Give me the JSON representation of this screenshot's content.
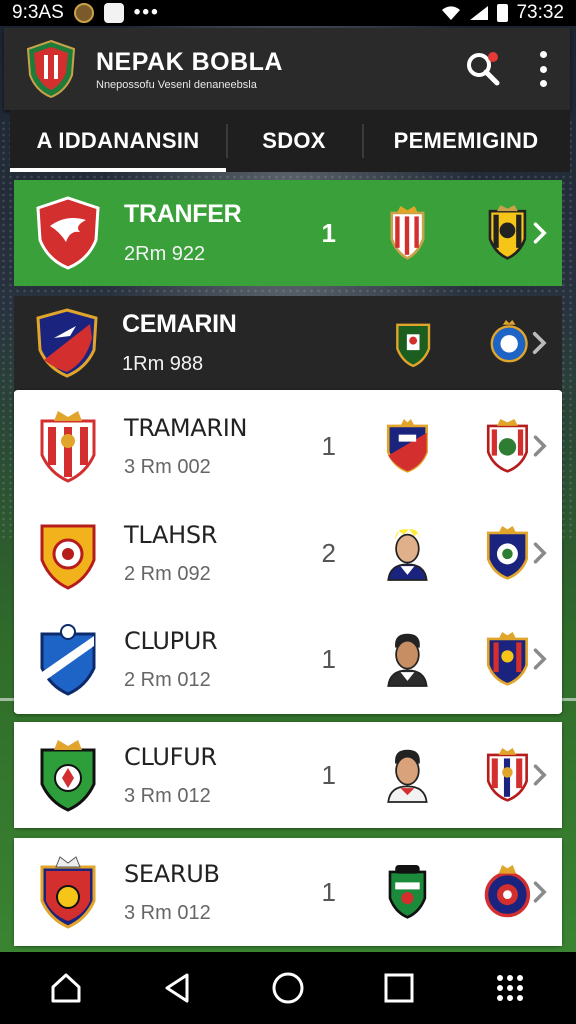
{
  "status_bar": {
    "left_time": "9:3AS",
    "right_time": "73:32"
  },
  "app": {
    "title": "NEPAK BOBLA",
    "subtitle": "Nnepossofu Vesenl denaneebsla"
  },
  "tabs": [
    {
      "label": "A IDDANANSIN",
      "active": true
    },
    {
      "label": "SDOX",
      "active": false
    },
    {
      "label": "PEMEMIGIND",
      "active": false
    }
  ],
  "matches": [
    {
      "name": "TRANFER",
      "time": "2Rm 922",
      "score": "1",
      "style": "highlight"
    },
    {
      "name": "CEMARIN",
      "time": "1Rm 988",
      "score": "",
      "style": "dark"
    },
    {
      "name": "TRAMARIN",
      "time": "3 Rm 002",
      "score": "1",
      "style": "light"
    },
    {
      "name": "TLAHSR",
      "time": "2 Rm 092",
      "score": "2",
      "style": "light"
    },
    {
      "name": "CLUPUR",
      "time": "2 Rm 012",
      "score": "1",
      "style": "light"
    },
    {
      "name": "CLUFUR",
      "time": "3 Rm 012",
      "score": "1",
      "style": "light"
    },
    {
      "name": "SEARUB",
      "time": "3 Rm 012",
      "score": "1",
      "style": "light"
    }
  ],
  "colors": {
    "accent_green": "#3aa13a",
    "app_bar": "#2a2a2a",
    "tab_bar": "#1f1f1f",
    "dark_row": "#262626",
    "notification": "#e53935"
  },
  "icons": [
    "search-icon",
    "more-vert-icon",
    "chevron-right-icon",
    "home-icon",
    "back-icon",
    "circle-home-icon",
    "recents-icon",
    "apps-grid-icon"
  ]
}
